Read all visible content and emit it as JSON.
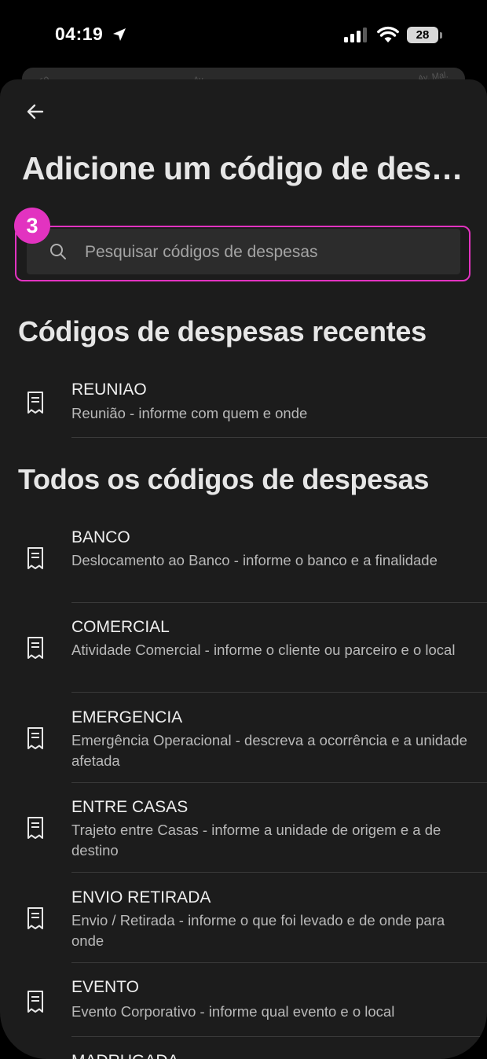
{
  "status_bar": {
    "time": "04:19",
    "battery": "28"
  },
  "map_peek": {
    "labels": [
      "Cruz Fo",
      "Av.",
      "Av. Mal."
    ]
  },
  "header": {
    "title": "Adicione um código de despesa"
  },
  "search": {
    "placeholder": "Pesquisar códigos de despesas",
    "value": "",
    "step_badge": "3",
    "highlight_color": "#e233c0"
  },
  "recent": {
    "title": "Códigos de despesas recentes",
    "items": [
      {
        "name": "REUNIAO",
        "description": "Reunião - informe com quem e onde"
      }
    ]
  },
  "all": {
    "title": "Todos os códigos de despesas",
    "items": [
      {
        "name": "BANCO",
        "description": "Deslocamento ao Banco - informe o banco e a finalidade"
      },
      {
        "name": "COMERCIAL",
        "description": "Atividade Comercial - informe o cliente ou parceiro e o local"
      },
      {
        "name": "EMERGENCIA",
        "description": "Emergência Operacional - descreva a ocorrência e a unidade afetada"
      },
      {
        "name": "ENTRE CASAS",
        "description": "Trajeto entre Casas - informe a unidade de origem e a de destino"
      },
      {
        "name": "ENVIO RETIRADA",
        "description": "Envio / Retirada - informe o que foi levado e de onde para onde"
      },
      {
        "name": "EVENTO",
        "description": "Evento Corporativo - informe qual evento e o local"
      },
      {
        "name": "MADRUGADA",
        "description": ""
      }
    ]
  },
  "icons": {
    "back": "arrow-left-icon",
    "search": "search-icon",
    "item": "receipt-icon"
  }
}
